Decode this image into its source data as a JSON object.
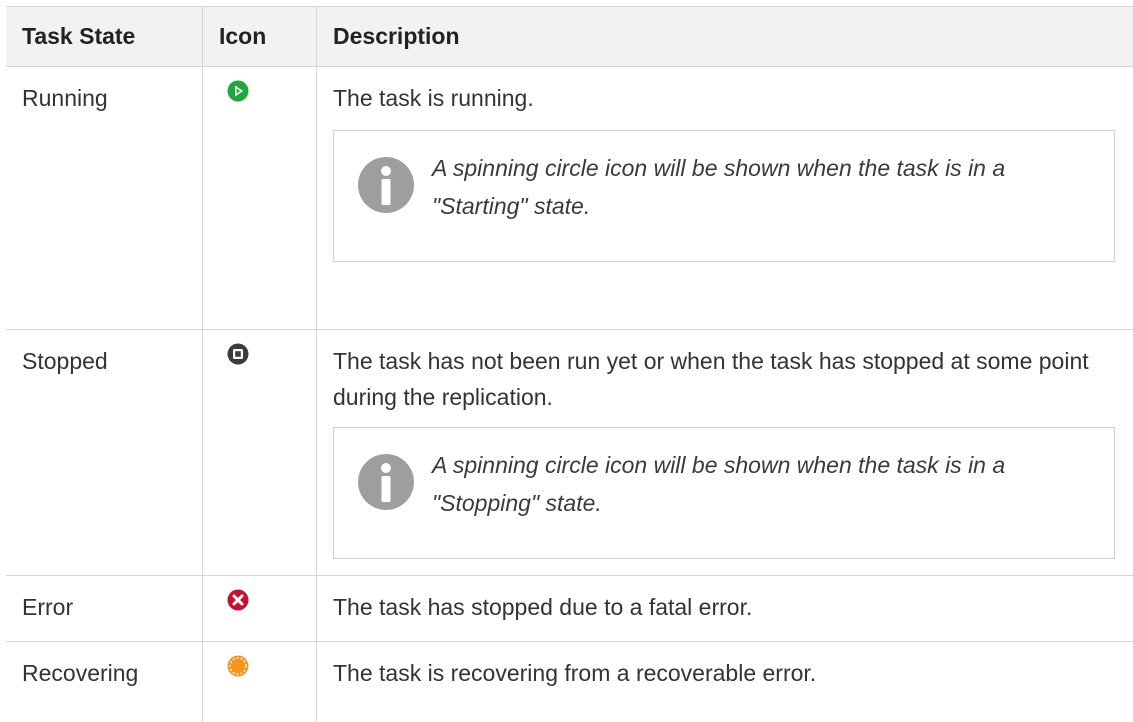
{
  "header": {
    "col_state": "Task State",
    "col_icon": "Icon",
    "col_desc": "Description"
  },
  "rows": [
    {
      "state": "Running",
      "icon": "running-play-icon",
      "icon_color": "#1ea83c",
      "description": "The task is running.",
      "note": "A spinning circle icon will be shown when the task is in a \"Starting\" state."
    },
    {
      "state": "Stopped",
      "icon": "stopped-square-icon",
      "icon_color": "#3c3c3c",
      "description": "The task has not been run yet or when the task has stopped at some point during the replication.",
      "note": "A spinning circle icon will be shown when the task is in a \"Stopping\" state."
    },
    {
      "state": "Error",
      "icon": "error-x-icon",
      "icon_color": "#c8102e",
      "description": "The task has stopped due to a fatal error."
    },
    {
      "state": "Recovering",
      "icon": "recovering-spinner-icon",
      "icon_color": "#f7941d",
      "description": "The task is recovering from a recoverable error."
    }
  ],
  "colors": {
    "header_bg": "#f2f2f2",
    "border": "#d6d6d6",
    "info_icon": "#9e9e9e"
  }
}
